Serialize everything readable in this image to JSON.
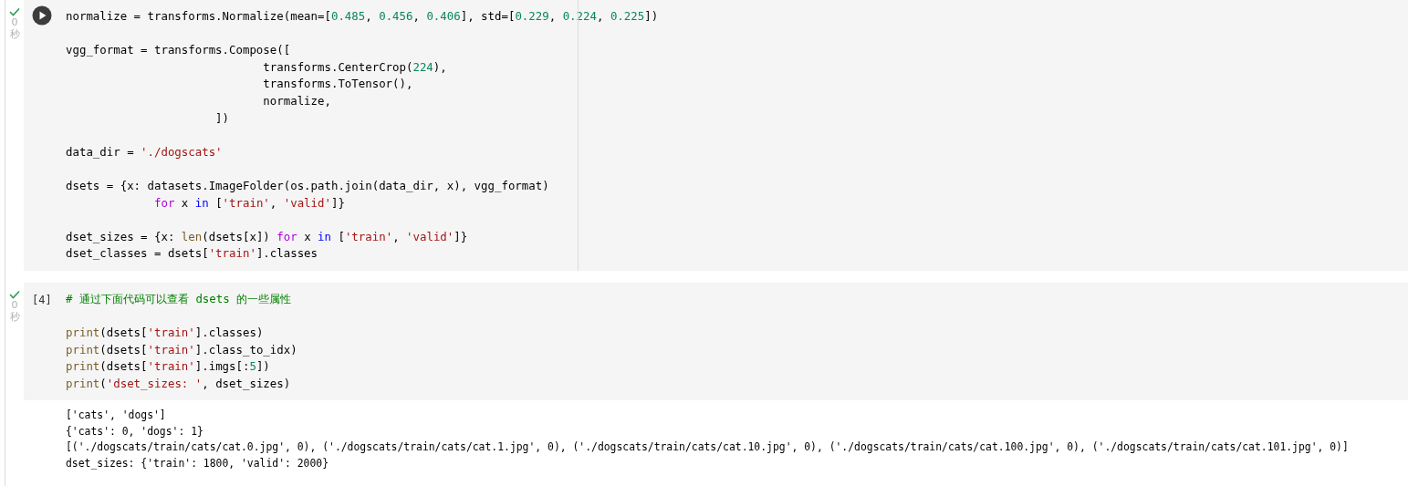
{
  "cells": [
    {
      "done": true,
      "time": "0",
      "unit": "秒",
      "run_button": true,
      "ruler": true,
      "blocks": [
        [
          {
            "tokens": [
              {
                "t": "normalize = transforms.Normalize(mean=[",
                "kind": "plain"
              },
              {
                "t": "0.485",
                "kind": "num"
              },
              {
                "t": ", ",
                "kind": "plain"
              },
              {
                "t": "0.456",
                "kind": "num"
              },
              {
                "t": ", ",
                "kind": "plain"
              },
              {
                "t": "0.406",
                "kind": "num"
              },
              {
                "t": "], std=[",
                "kind": "plain"
              },
              {
                "t": "0.229",
                "kind": "num"
              },
              {
                "t": ", ",
                "kind": "plain"
              },
              {
                "t": "0.224",
                "kind": "num"
              },
              {
                "t": ", ",
                "kind": "plain"
              },
              {
                "t": "0.225",
                "kind": "num"
              },
              {
                "t": "])",
                "kind": "plain"
              }
            ]
          }
        ],
        [
          {
            "tokens": [
              {
                "t": "vgg_format = transforms.Compose([",
                "kind": "plain"
              }
            ]
          },
          {
            "tokens": [
              {
                "t": "                             transforms.CenterCrop(",
                "kind": "plain"
              },
              {
                "t": "224",
                "kind": "num"
              },
              {
                "t": "),",
                "kind": "plain"
              }
            ]
          },
          {
            "tokens": [
              {
                "t": "                             transforms.ToTensor(),",
                "kind": "plain"
              }
            ]
          },
          {
            "tokens": [
              {
                "t": "                             normalize,",
                "kind": "plain"
              }
            ]
          },
          {
            "tokens": [
              {
                "t": "                      ])",
                "kind": "plain"
              }
            ]
          }
        ],
        [
          {
            "tokens": [
              {
                "t": "data_dir = ",
                "kind": "plain"
              },
              {
                "t": "'./dogscats'",
                "kind": "str"
              }
            ]
          }
        ],
        [
          {
            "tokens": [
              {
                "t": "dsets = {x: datasets.ImageFolder(os.path.join(data_dir, x), vgg_format)",
                "kind": "plain"
              }
            ]
          },
          {
            "hanging": true,
            "tokens": [
              {
                "t": "for",
                "kind": "kw"
              },
              {
                "t": " x ",
                "kind": "plain"
              },
              {
                "t": "in",
                "kind": "op"
              },
              {
                "t": " [",
                "kind": "plain"
              },
              {
                "t": "'train'",
                "kind": "str"
              },
              {
                "t": ", ",
                "kind": "plain"
              },
              {
                "t": "'valid'",
                "kind": "str"
              },
              {
                "t": "]}",
                "kind": "plain"
              }
            ]
          }
        ],
        [
          {
            "tokens": [
              {
                "t": "dset_sizes = {x: ",
                "kind": "plain"
              },
              {
                "t": "len",
                "kind": "fn"
              },
              {
                "t": "(dsets[x]) ",
                "kind": "plain"
              },
              {
                "t": "for",
                "kind": "kw"
              },
              {
                "t": " x ",
                "kind": "plain"
              },
              {
                "t": "in",
                "kind": "op"
              },
              {
                "t": " [",
                "kind": "plain"
              },
              {
                "t": "'train'",
                "kind": "str"
              },
              {
                "t": ", ",
                "kind": "plain"
              },
              {
                "t": "'valid'",
                "kind": "str"
              },
              {
                "t": "]}",
                "kind": "plain"
              }
            ]
          },
          {
            "tokens": [
              {
                "t": "dset_classes = dsets[",
                "kind": "plain"
              },
              {
                "t": "'train'",
                "kind": "str"
              },
              {
                "t": "].classes",
                "kind": "plain"
              }
            ]
          }
        ]
      ]
    },
    {
      "done": true,
      "time": "0",
      "unit": "秒",
      "run_button": false,
      "count": "[4]",
      "ruler": false,
      "blocks": [
        [
          {
            "tokens": [
              {
                "t": "# 通过下面代码可以查看 dsets 的一些属性",
                "kind": "comment"
              }
            ]
          }
        ],
        [
          {
            "tokens": [
              {
                "t": "print",
                "kind": "fn"
              },
              {
                "t": "(dsets[",
                "kind": "plain"
              },
              {
                "t": "'train'",
                "kind": "str"
              },
              {
                "t": "].classes)",
                "kind": "plain"
              }
            ]
          },
          {
            "tokens": [
              {
                "t": "print",
                "kind": "fn"
              },
              {
                "t": "(dsets[",
                "kind": "plain"
              },
              {
                "t": "'train'",
                "kind": "str"
              },
              {
                "t": "].class_to_idx)",
                "kind": "plain"
              }
            ]
          },
          {
            "tokens": [
              {
                "t": "print",
                "kind": "fn"
              },
              {
                "t": "(dsets[",
                "kind": "plain"
              },
              {
                "t": "'train'",
                "kind": "str"
              },
              {
                "t": "].imgs[:",
                "kind": "plain"
              },
              {
                "t": "5",
                "kind": "num"
              },
              {
                "t": "])",
                "kind": "plain"
              }
            ]
          },
          {
            "tokens": [
              {
                "t": "print",
                "kind": "fn"
              },
              {
                "t": "(",
                "kind": "plain"
              },
              {
                "t": "'dset_sizes: '",
                "kind": "str"
              },
              {
                "t": ", dset_sizes)",
                "kind": "plain"
              }
            ]
          }
        ]
      ],
      "output": [
        "['cats', 'dogs']",
        "{'cats': 0, 'dogs': 1}",
        "[('./dogscats/train/cats/cat.0.jpg', 0), ('./dogscats/train/cats/cat.1.jpg', 0), ('./dogscats/train/cats/cat.10.jpg', 0), ('./dogscats/train/cats/cat.100.jpg', 0), ('./dogscats/train/cats/cat.101.jpg', 0)]",
        "dset_sizes: {'train': 1800, 'valid': 2000}"
      ]
    }
  ]
}
